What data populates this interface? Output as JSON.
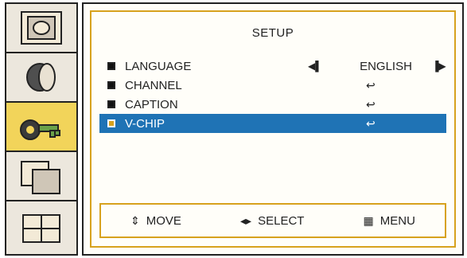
{
  "sidebar": {
    "items": [
      {
        "name": "picture"
      },
      {
        "name": "sound"
      },
      {
        "name": "setup"
      },
      {
        "name": "pip"
      },
      {
        "name": "channel"
      }
    ]
  },
  "setup": {
    "title": "SETUP",
    "rows": [
      {
        "label": "LANGUAGE",
        "value": "ENGLISH"
      },
      {
        "label": "CHANNEL"
      },
      {
        "label": "CAPTION"
      },
      {
        "label": "V-CHIP"
      }
    ],
    "footer": {
      "move": "MOVE",
      "select": "SELECT",
      "menu": "MENU"
    }
  }
}
